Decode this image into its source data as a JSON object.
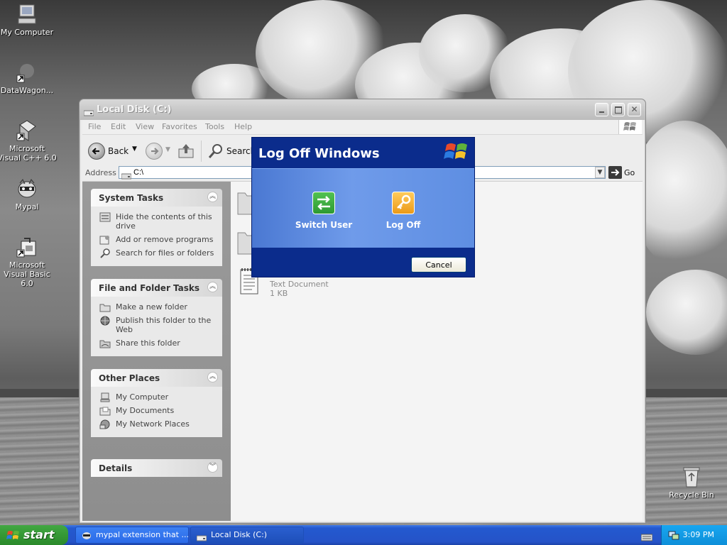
{
  "desktop": {
    "icons": [
      {
        "label": "My Computer",
        "icon": "my-computer-icon"
      },
      {
        "label": "DataWagon...",
        "icon": "shortcut-icon"
      },
      {
        "label": "Microsoft Visual C++ 6.0",
        "icon": "visual-cpp-icon"
      },
      {
        "label": "Mypal",
        "icon": "mypal-icon"
      },
      {
        "label": "Microsoft Visual Basic 6.0",
        "icon": "visual-basic-icon"
      },
      {
        "label": "Recycle Bin",
        "icon": "recycle-bin-icon"
      }
    ]
  },
  "explorer": {
    "title": "Local Disk (C:)",
    "menu": [
      "File",
      "Edit",
      "View",
      "Favorites",
      "Tools",
      "Help"
    ],
    "toolbar": {
      "back": "Back",
      "search": "Search"
    },
    "address": {
      "label": "Address",
      "value": "C:\\",
      "go": "Go"
    },
    "panels": {
      "system_tasks": {
        "title": "System Tasks",
        "items": [
          "Hide the contents of this drive",
          "Add or remove programs",
          "Search for files or folders"
        ]
      },
      "file_folder_tasks": {
        "title": "File and Folder Tasks",
        "items": [
          "Make a new folder",
          "Publish this folder to the Web",
          "Share this folder"
        ]
      },
      "other_places": {
        "title": "Other Places",
        "items": [
          "My Computer",
          "My Documents",
          "My Network Places"
        ]
      },
      "details": {
        "title": "Details"
      }
    },
    "files": [
      {
        "name": "",
        "type": "folder"
      },
      {
        "name": "",
        "type": "folder"
      },
      {
        "name": "",
        "type": "Text Document",
        "size": "1 KB"
      }
    ]
  },
  "dialog": {
    "title": "Log Off Windows",
    "switch_user": "Switch User",
    "log_off": "Log Off",
    "cancel": "Cancel"
  },
  "taskbar": {
    "start": "start",
    "tasks": [
      "mypal extension that ...",
      "Local Disk (C:)"
    ],
    "clock": "3:09 PM"
  },
  "colors": {
    "taskbar": "#2459cf",
    "start_button": "#379b37",
    "dialog_band": "#0b2c8c",
    "dialog_body": "#6f9bea",
    "switch_user_icon": "#2ea043",
    "log_off_icon": "#f0a21e"
  }
}
